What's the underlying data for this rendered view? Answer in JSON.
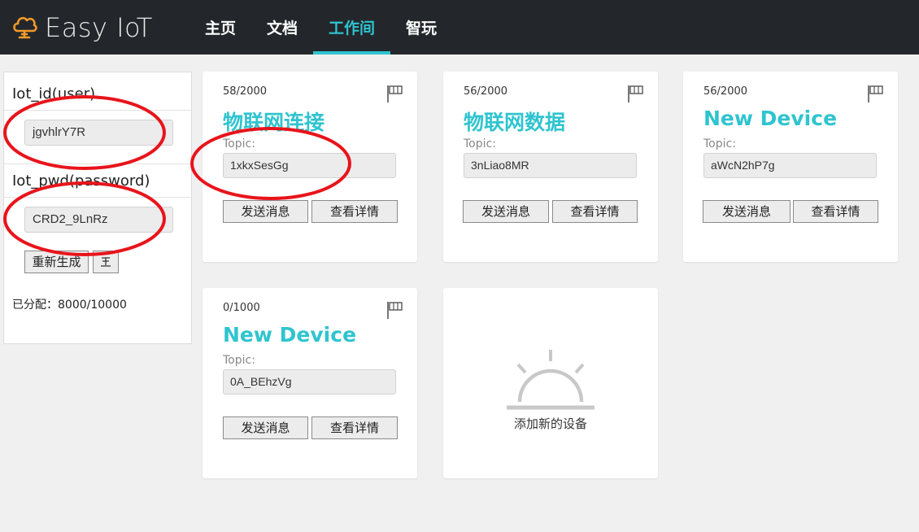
{
  "header": {
    "brand": "Easy IoT",
    "nav": [
      {
        "label": "主页",
        "active": false
      },
      {
        "label": "文档",
        "active": false
      },
      {
        "label": "工作间",
        "active": true
      },
      {
        "label": "智玩",
        "active": false
      }
    ]
  },
  "credentials": {
    "id_label": "Iot_id(user)",
    "id_value": "jgvhlrY7R",
    "pwd_label": "Iot_pwd(password)",
    "pwd_value": "CRD2_9LnRz",
    "regen_label": "重新生成",
    "quota_text": "已分配：8000/10000"
  },
  "devices": [
    {
      "count": "58/2000",
      "title": "物联网连接",
      "topic_label": "Topic:",
      "topic": "1xkxSesGg",
      "send_label": "发送消息",
      "detail_label": "查看详情"
    },
    {
      "count": "56/2000",
      "title": "物联网数据",
      "topic_label": "Topic:",
      "topic": "3nLiao8MR",
      "send_label": "发送消息",
      "detail_label": "查看详情"
    },
    {
      "count": "56/2000",
      "title": "New Device",
      "topic_label": "Topic:",
      "topic": "aWcN2hP7g",
      "send_label": "发送消息",
      "detail_label": "查看详情"
    },
    {
      "count": "0/1000",
      "title": "New Device",
      "topic_label": "Topic:",
      "topic": "0A_BEhzVg",
      "send_label": "发送消息",
      "detail_label": "查看详情"
    }
  ],
  "add_device": {
    "label": "添加新的设备"
  },
  "colors": {
    "accent": "#2fc4cf",
    "header_bg": "#23272b",
    "annotation": "#e8141b"
  },
  "icons": [
    "cloud-logo-icon",
    "flag-icon",
    "copy-icon",
    "sunrise-icon"
  ]
}
